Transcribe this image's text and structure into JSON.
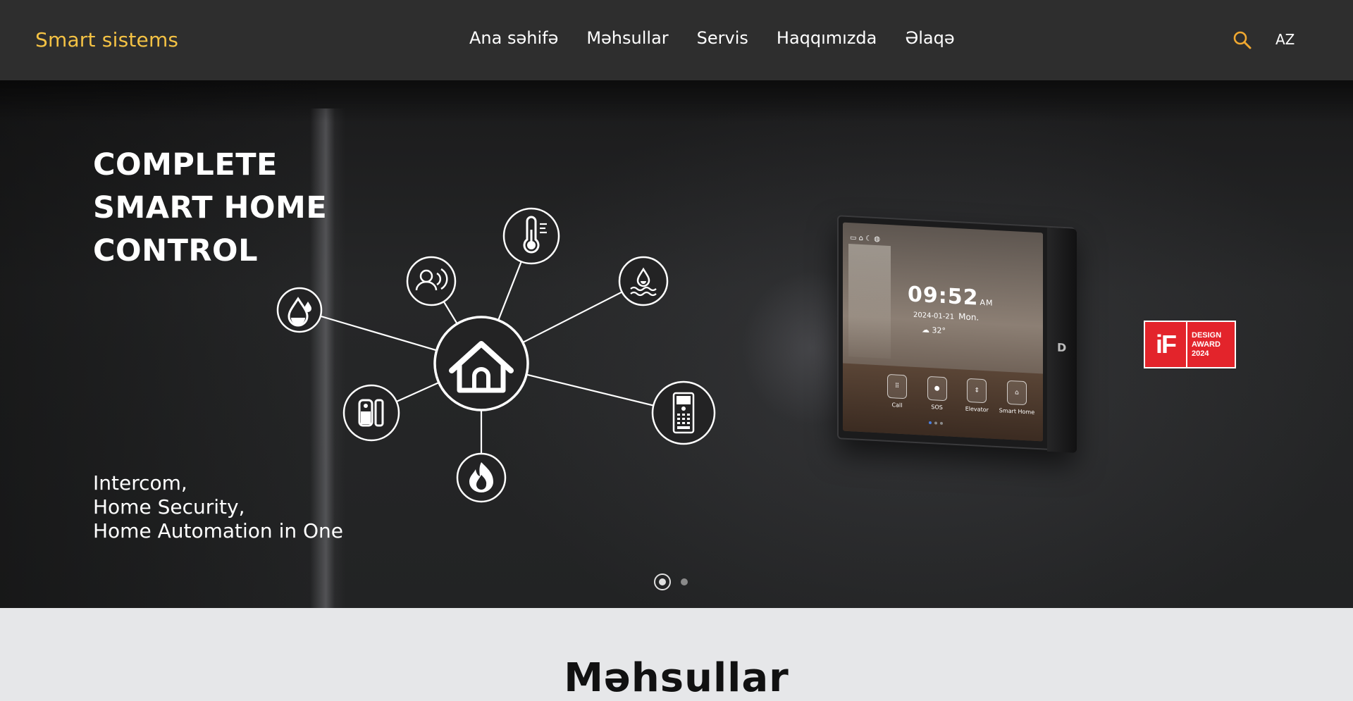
{
  "header": {
    "logo": "Smart sistems",
    "nav": [
      "Ana səhifə",
      "Məhsullar",
      "Servis",
      "Haqqımızda",
      "Əlaqə"
    ],
    "search_icon": "search-icon",
    "language": "AZ"
  },
  "hero": {
    "title_lines": [
      "COMPLETE",
      "SMART HOME",
      "CONTROL"
    ],
    "subtitle_lines": [
      "Intercom,",
      "Home Security,",
      "Home Automation in One"
    ],
    "hub_icons": [
      "home-icon",
      "water-drop-icon",
      "presence-sensor-icon",
      "thermometer-icon",
      "water-leak-icon",
      "door-sensor-icon",
      "fire-icon",
      "door-station-icon"
    ],
    "tablet": {
      "time": "09:52",
      "ampm": "AM",
      "date": "2024-01-21",
      "weekday": "Mon.",
      "temperature": "32°",
      "apps": [
        {
          "label": "Call",
          "icon": "keypad-icon"
        },
        {
          "label": "SOS",
          "icon": "sos-icon"
        },
        {
          "label": "Elevator",
          "icon": "elevator-icon"
        },
        {
          "label": "Smart Home",
          "icon": "home-lock-icon"
        }
      ]
    },
    "award": {
      "mark": "iF",
      "lines": [
        "DESIGN",
        "AWARD",
        "2024"
      ]
    },
    "slides": {
      "total": 2,
      "active": 1
    }
  },
  "colors": {
    "header_bg": "#2e2e2e",
    "logo": "#f4c244",
    "search_icon": "#f0a830",
    "award_red": "#e3242b",
    "page_bg": "#e6e7e9"
  },
  "section": {
    "title": "Məhsullar"
  }
}
